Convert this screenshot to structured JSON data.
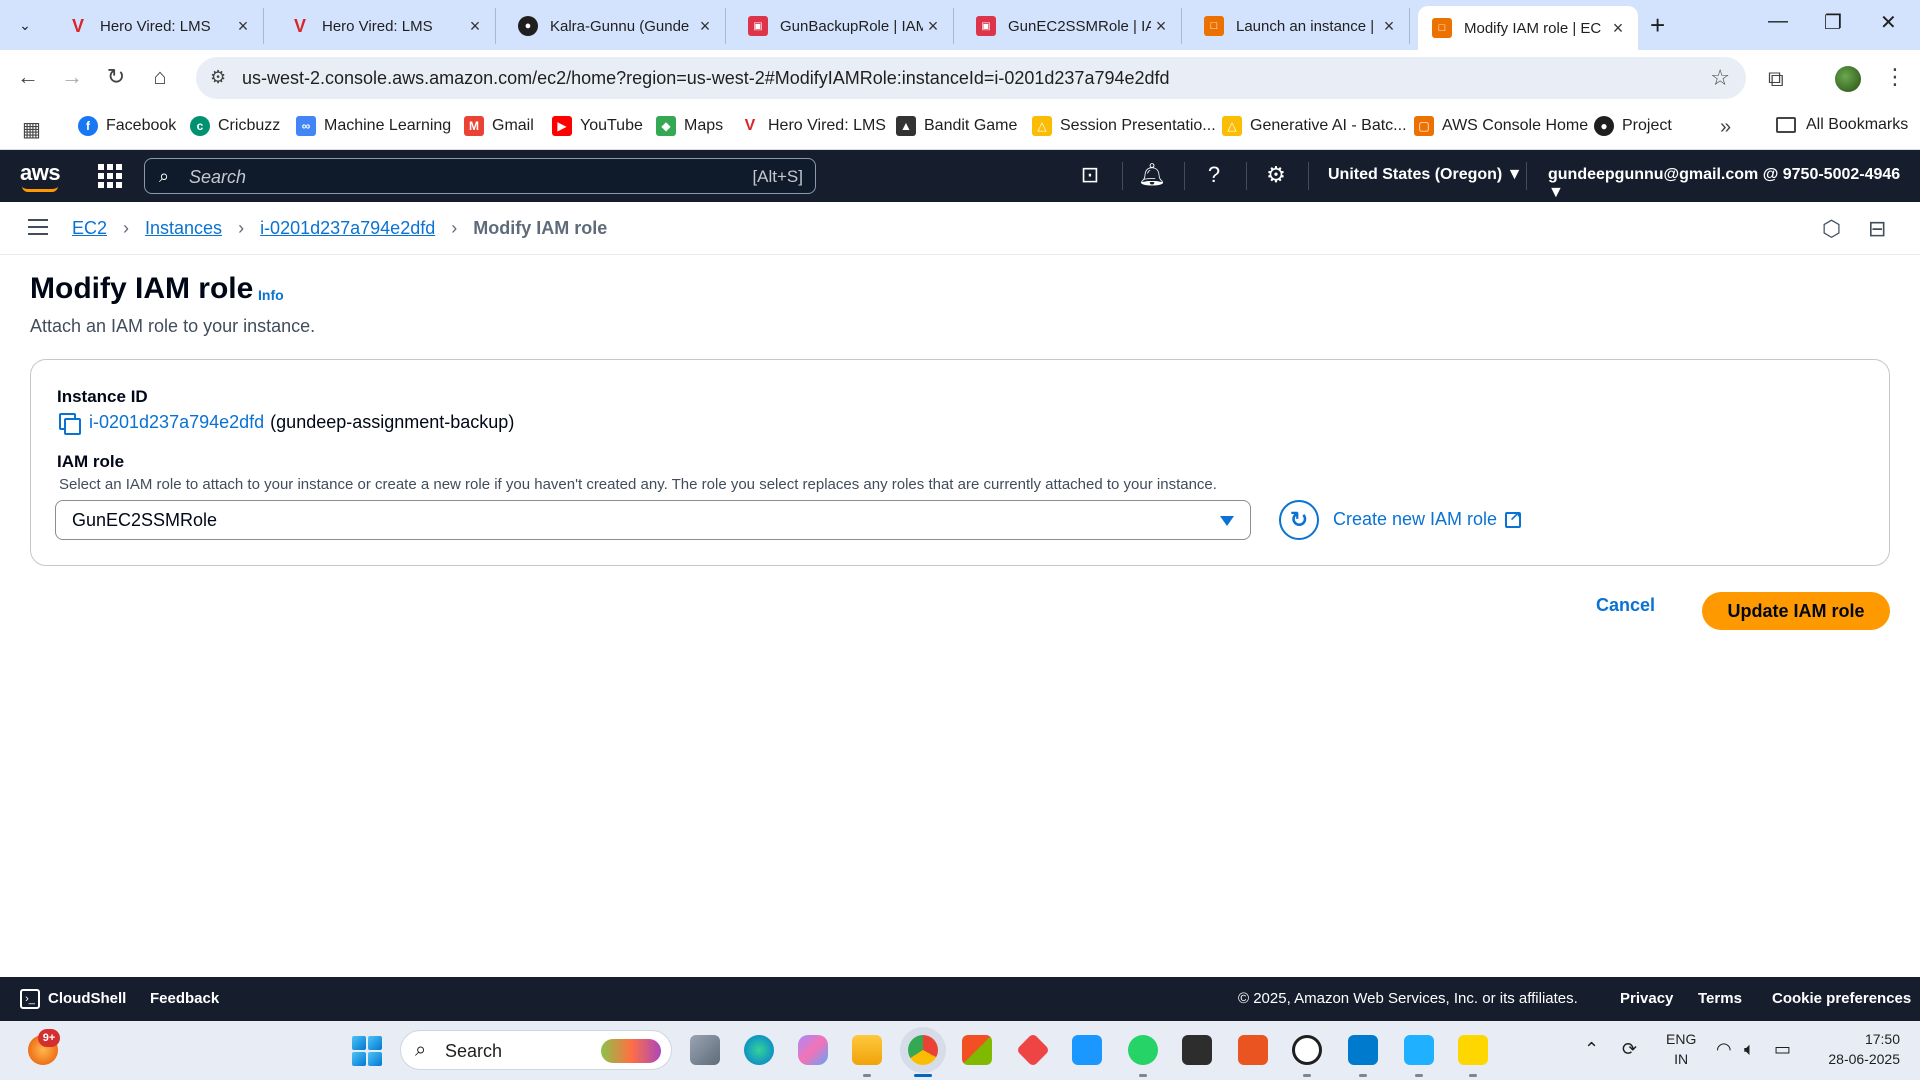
{
  "browser": {
    "tabs": [
      {
        "title": "Hero Vired: LMS",
        "favicon": "hero-vired-icon"
      },
      {
        "title": "Hero Vired: LMS",
        "favicon": "hero-vired-icon"
      },
      {
        "title": "Kalra-Gunnu (Gunde",
        "favicon": "github-icon"
      },
      {
        "title": "GunBackupRole | IAM",
        "favicon": "iam-icon"
      },
      {
        "title": "GunEC2SSMRole | IA",
        "favicon": "iam-icon"
      },
      {
        "title": "Launch an instance |",
        "favicon": "ec2-icon"
      },
      {
        "title": "Modify IAM role | EC",
        "favicon": "ec2-icon"
      }
    ],
    "url": "us-west-2.console.aws.amazon.com/ec2/home?region=us-west-2#ModifyIAMRole:instanceId=i-0201d237a794e2dfd",
    "bookmarks": [
      {
        "label": "Facebook",
        "icon": "facebook-icon",
        "color": "#1877f2"
      },
      {
        "label": "Cricbuzz",
        "icon": "cricbuzz-icon",
        "color": "#009270"
      },
      {
        "label": "Machine Learning",
        "icon": "machine-learning-icon",
        "color": "#4285f4"
      },
      {
        "label": "Gmail",
        "icon": "gmail-icon",
        "color": "#ea4335"
      },
      {
        "label": "YouTube",
        "icon": "youtube-icon",
        "color": "#ff0000"
      },
      {
        "label": "Maps",
        "icon": "maps-icon",
        "color": "#34a853"
      },
      {
        "label": "Hero Vired: LMS",
        "icon": "hero-vired-icon",
        "color": "#d9262b"
      },
      {
        "label": "Bandit Game",
        "icon": "bandit-game-icon",
        "color": "#333333"
      },
      {
        "label": "Session Presentatio...",
        "icon": "drive-icon",
        "color": "#fbbc04"
      },
      {
        "label": "Generative AI - Batc...",
        "icon": "drive-icon",
        "color": "#fbbc04"
      },
      {
        "label": "AWS Console Home",
        "icon": "aws-icon",
        "color": "#ed7100"
      },
      {
        "label": "Project",
        "icon": "github-icon",
        "color": "#1f1f1f"
      }
    ],
    "all_bookmarks": "All Bookmarks"
  },
  "aws": {
    "logo": "aws",
    "search_placeholder": "Search",
    "search_shortcut": "[Alt+S]",
    "region": "United States (Oregon) ▼",
    "account": "gundeepgunnu@gmail.com @ 9750-5002-4946 ▼"
  },
  "breadcrumb": {
    "items": [
      "EC2",
      "Instances",
      "i-0201d237a794e2dfd"
    ],
    "current": "Modify IAM role"
  },
  "page": {
    "title": "Modify IAM role",
    "info": "Info",
    "subtitle": "Attach an IAM role to your instance."
  },
  "form": {
    "instance_label": "Instance ID",
    "instance_id": "i-0201d237a794e2dfd",
    "instance_name": "(gundeep-assignment-backup)",
    "role_label": "IAM role",
    "role_desc": "Select an IAM role to attach to your instance or create a new role if you haven't created any. The role you select replaces any roles that are currently attached to your instance.",
    "role_value": "GunEC2SSMRole",
    "create_role": "Create new IAM role"
  },
  "actions": {
    "cancel": "Cancel",
    "update": "Update IAM role"
  },
  "footer": {
    "cloudshell": "CloudShell",
    "feedback": "Feedback",
    "copyright": "© 2025, Amazon Web Services, Inc. or its affiliates.",
    "privacy": "Privacy",
    "terms": "Terms",
    "cookies": "Cookie preferences"
  },
  "taskbar": {
    "badge": "9+",
    "search": "Search",
    "lang1": "ENG",
    "lang2": "IN",
    "time": "17:50",
    "date": "28-06-2025"
  },
  "colors": {
    "aws_nav": "#161e2d",
    "link": "#0972d3",
    "primary_button": "#ff9900"
  }
}
